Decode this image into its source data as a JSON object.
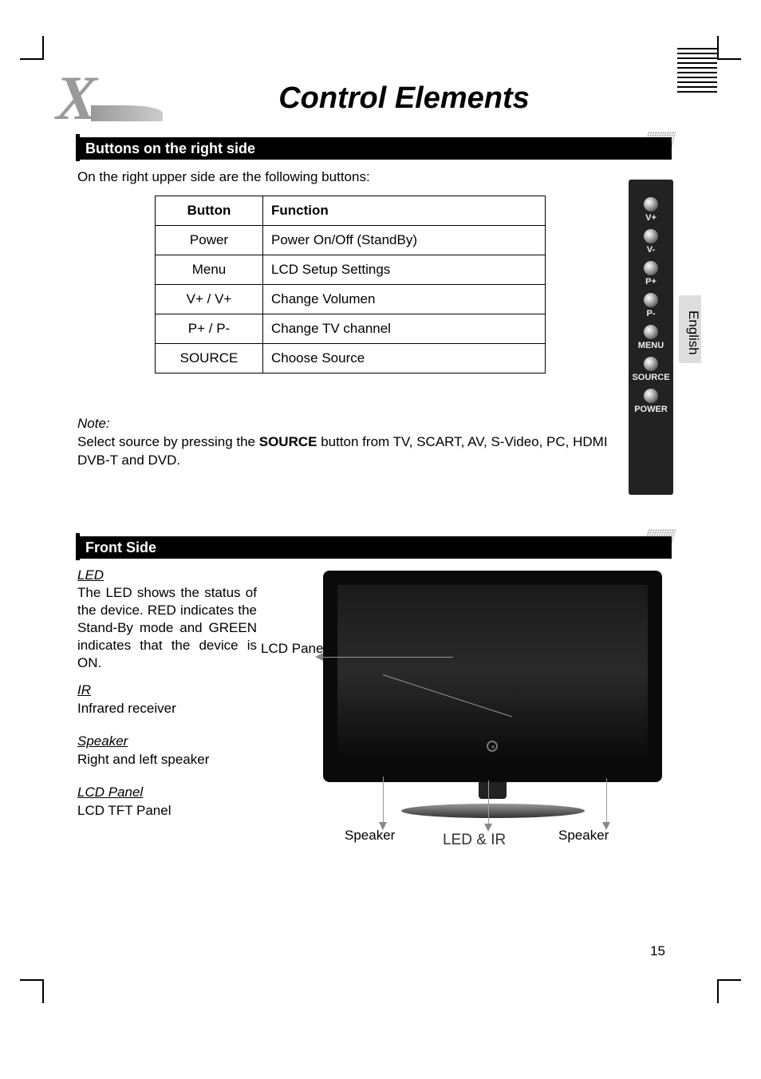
{
  "title": "Control Elements",
  "section1": {
    "heading": "Buttons on the right side",
    "intro": "On the right upper side are the following buttons:"
  },
  "table": {
    "headers": {
      "button": "Button",
      "function": "Function"
    },
    "rows": [
      {
        "button": "Power",
        "function": "Power On/Off (StandBy)"
      },
      {
        "button": "Menu",
        "function": "LCD Setup Settings"
      },
      {
        "button": "V+ / V+",
        "function": "Change Volumen"
      },
      {
        "button": "P+ / P-",
        "function": "Change TV channel"
      },
      {
        "button": "SOURCE",
        "function": "Choose Source"
      }
    ]
  },
  "note": {
    "label": "Note:",
    "pre": "Select source by pressing the ",
    "bold": "SOURCE",
    "post": " button from TV, SCART,  AV, S-Video, PC, HDMI DVB-T and DVD."
  },
  "side_buttons": [
    "V+",
    "V-",
    "P+",
    "P-",
    "MENU",
    "SOURCE",
    "POWER"
  ],
  "language": "English",
  "section2": {
    "heading": "Front Side",
    "led": {
      "title": "LED",
      "text": "The LED shows the status of the device. RED indicates the Stand-By mode and GREEN indicates that the device is ON."
    },
    "ir": {
      "title": "IR",
      "text": "Infrared receiver"
    },
    "speaker": {
      "title": "Speaker",
      "text": "Right and left speaker"
    },
    "lcd": {
      "title": "LCD Panel",
      "text": "LCD TFT Panel"
    }
  },
  "diagram_labels": {
    "lcd_panel": "LCD Panel",
    "speaker_l": "Speaker",
    "speaker_r": "Speaker",
    "led_ir": "LED & IR"
  },
  "page_number": "15"
}
